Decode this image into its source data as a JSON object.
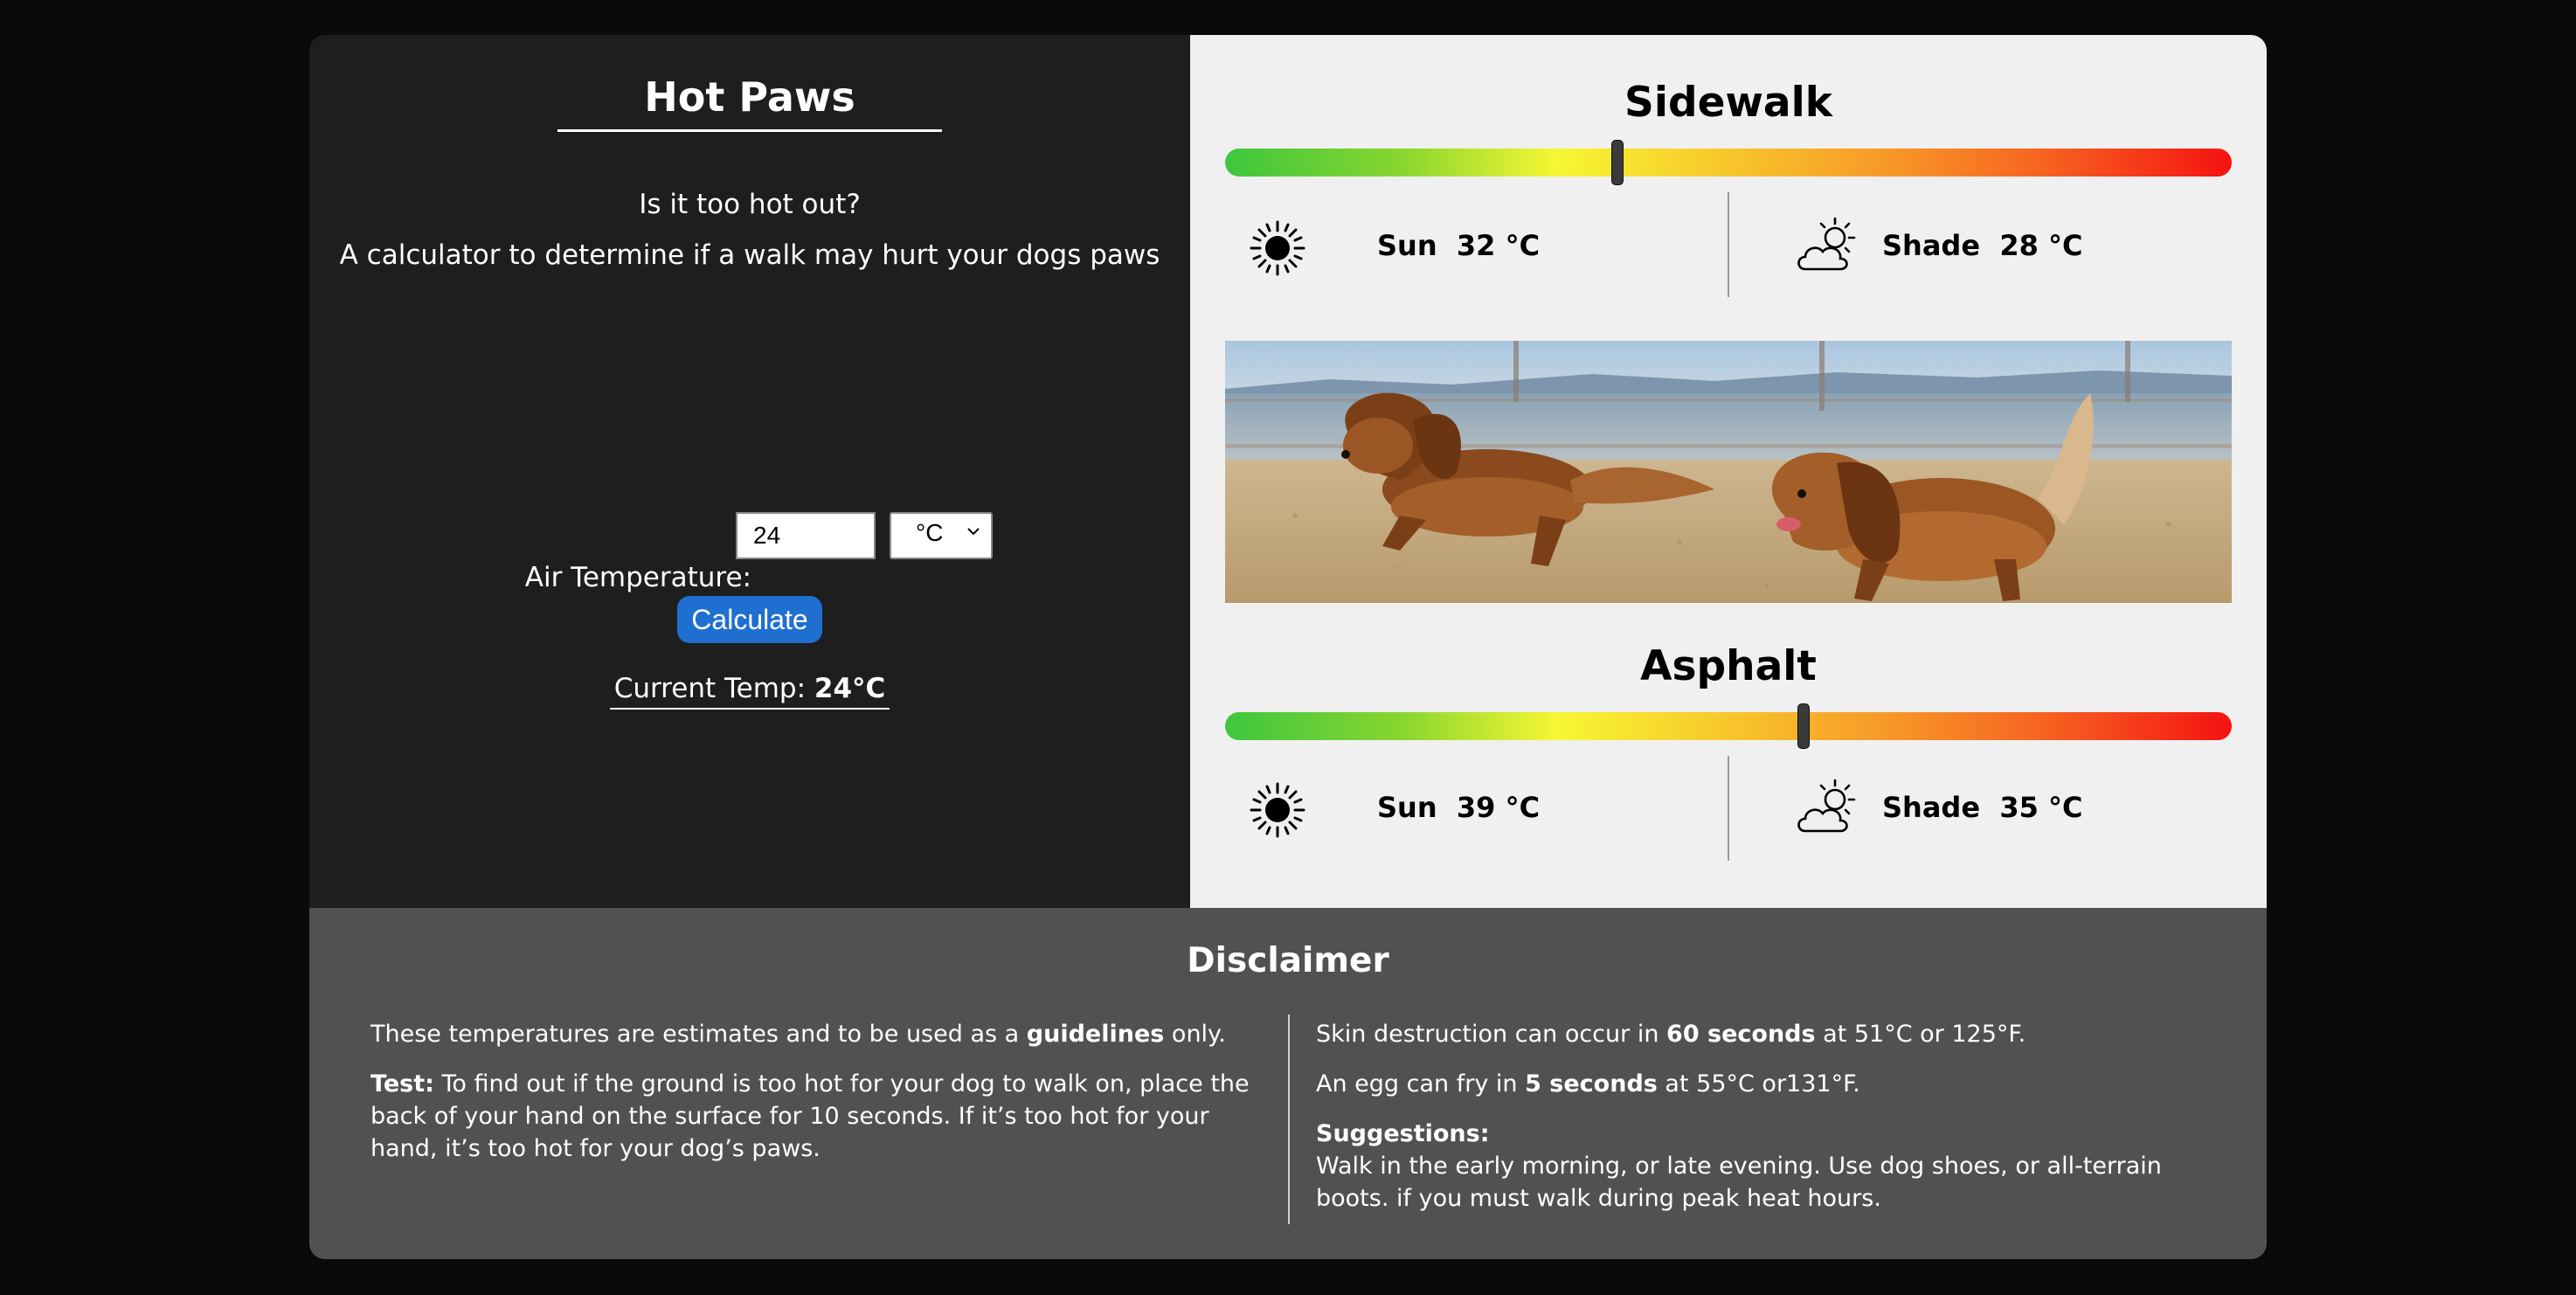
{
  "app": {
    "title": "Hot Paws",
    "subtitle_question": "Is it too hot out?",
    "subtitle_description": "A calculator to determine if a walk may hurt your dogs paws"
  },
  "form": {
    "air_temperature_label": "Air Temperature:",
    "air_temperature_value": "24",
    "unit_selected": "°C",
    "calculate_label": "Calculate",
    "current_temp_label": "Current Temp:",
    "current_temp_value": "24°C"
  },
  "sidewalk": {
    "title": "Sidewalk",
    "gauge_level_fraction": 0.39,
    "sun_label": "Sun",
    "sun_value": "32 °C",
    "shade_label": "Shade",
    "shade_value": "28 °C"
  },
  "asphalt": {
    "title": "Asphalt",
    "gauge_level_fraction": 0.575,
    "sun_label": "Sun",
    "sun_value": "39 °C",
    "shade_label": "Shade",
    "shade_value": "35 °C"
  },
  "photo": {
    "description": "two-dogs-on-beach"
  },
  "disclaimer": {
    "title": "Disclaimer",
    "left": {
      "p1_pre": "These temperatures are estimates and to be used as a ",
      "p1_bold": "guidelines",
      "p1_post": " only.",
      "p2_bold": "Test:",
      "p2_text": " To find out if the ground is too hot for your dog to walk on, place the back of your hand on the surface for 10 seconds. If it’s too hot for your hand, it’s too hot for your dog’s paws."
    },
    "right": {
      "p1_pre": "Skin destruction can occur in ",
      "p1_bold": "60 seconds",
      "p1_post": " at 51°C or 125°F.",
      "p2_pre": "An egg can fry in ",
      "p2_bold": "5 seconds",
      "p2_post": " at 55°C or131°F.",
      "suggestions_label": "Suggestions:",
      "suggestions_text": "Walk in the early morning, or late evening. Use dog shoes, or all-terrain boots. if you must walk during peak heat hours."
    }
  },
  "icons": {
    "sun": "sun-icon",
    "partly_cloudy": "partly-cloudy-icon"
  },
  "colors": {
    "left_panel_bg": "#1e1e1e",
    "right_panel_bg": "#f0f0f0",
    "disclaimer_bg": "#515151",
    "button_blue": "#1f6fd1",
    "gauge_start": "#3ec63e",
    "gauge_mid": "#f7f733",
    "gauge_end": "#f51212"
  }
}
